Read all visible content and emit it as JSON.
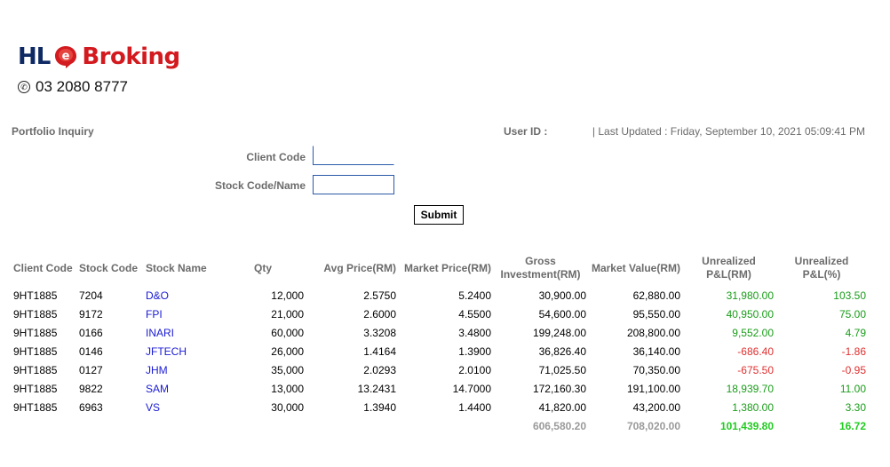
{
  "brand": {
    "prefix": "HL",
    "name": "Broking",
    "phone": "03 2080 8777"
  },
  "header": {
    "page_title": "Portfolio Inquiry",
    "user_id_label": "User ID :",
    "last_updated": "| Last Updated : Friday, September 10, 2021 05:09:41 PM"
  },
  "form": {
    "client_code_label": "Client Code",
    "client_code_value": "",
    "stock_label": "Stock Code/Name",
    "stock_value": "",
    "submit_label": "Submit"
  },
  "table": {
    "headers": {
      "client_code": "Client Code",
      "stock_code": "Stock Code",
      "stock_name": "Stock Name",
      "qty": "Qty",
      "avg_price": "Avg Price(RM)",
      "market_price": "Market Price(RM)",
      "gross_line1": "Gross",
      "gross_line2": "Investment(RM)",
      "market_value": "Market Value(RM)",
      "unreal_rm_line1": "Unrealized",
      "unreal_rm_line2": "P&L(RM)",
      "unreal_pct_line1": "Unrealized",
      "unreal_pct_line2": "P&L(%)"
    },
    "rows": [
      {
        "client": "9HT1885",
        "code": "7204",
        "name": "D&O",
        "qty": "12,000",
        "avg": "2.5750",
        "mkt": "5.2400",
        "gross": "30,900.00",
        "value": "62,880.00",
        "pl": "31,980.00",
        "pct": "103.50",
        "sign": "pos"
      },
      {
        "client": "9HT1885",
        "code": "9172",
        "name": "FPI",
        "qty": "21,000",
        "avg": "2.6000",
        "mkt": "4.5500",
        "gross": "54,600.00",
        "value": "95,550.00",
        "pl": "40,950.00",
        "pct": "75.00",
        "sign": "pos"
      },
      {
        "client": "9HT1885",
        "code": "0166",
        "name": "INARI",
        "qty": "60,000",
        "avg": "3.3208",
        "mkt": "3.4800",
        "gross": "199,248.00",
        "value": "208,800.00",
        "pl": "9,552.00",
        "pct": "4.79",
        "sign": "pos"
      },
      {
        "client": "9HT1885",
        "code": "0146",
        "name": "JFTECH",
        "qty": "26,000",
        "avg": "1.4164",
        "mkt": "1.3900",
        "gross": "36,826.40",
        "value": "36,140.00",
        "pl": "-686.40",
        "pct": "-1.86",
        "sign": "neg"
      },
      {
        "client": "9HT1885",
        "code": "0127",
        "name": "JHM",
        "qty": "35,000",
        "avg": "2.0293",
        "mkt": "2.0100",
        "gross": "71,025.50",
        "value": "70,350.00",
        "pl": "-675.50",
        "pct": "-0.95",
        "sign": "neg"
      },
      {
        "client": "9HT1885",
        "code": "9822",
        "name": "SAM",
        "qty": "13,000",
        "avg": "13.2431",
        "mkt": "14.7000",
        "gross": "172,160.30",
        "value": "191,100.00",
        "pl": "18,939.70",
        "pct": "11.00",
        "sign": "pos"
      },
      {
        "client": "9HT1885",
        "code": "6963",
        "name": "VS",
        "qty": "30,000",
        "avg": "1.3940",
        "mkt": "1.4400",
        "gross": "41,820.00",
        "value": "43,200.00",
        "pl": "1,380.00",
        "pct": "3.30",
        "sign": "pos"
      }
    ],
    "totals": {
      "gross": "606,580.20",
      "value": "708,020.00",
      "pl": "101,439.80",
      "pct": "16.72"
    }
  },
  "colors": {
    "brand_navy": "#0f2a63",
    "brand_red": "#d21a1f",
    "link": "#1a1ad4",
    "gain": "#1a9c1a",
    "loss": "#e03030",
    "total_gain": "#22cc22"
  },
  "icons": {
    "logo_mark": "red-e-logo-icon",
    "phone": "phone-icon"
  }
}
